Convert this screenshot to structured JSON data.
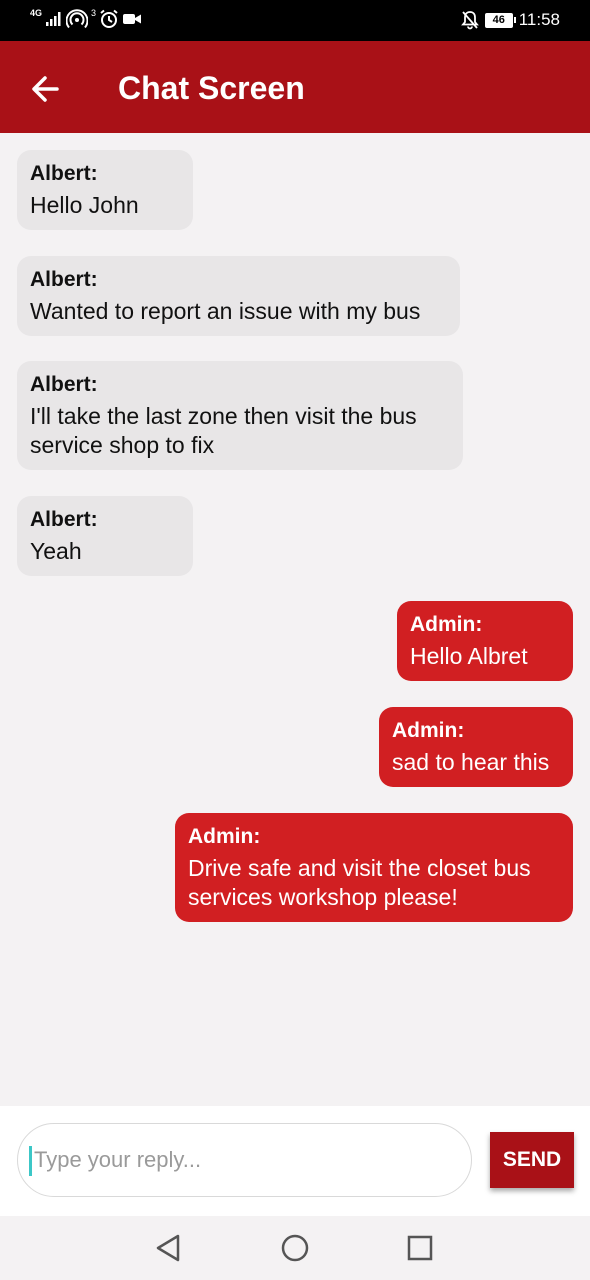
{
  "status_bar": {
    "network": "4G",
    "time": "11:58",
    "battery": "46"
  },
  "app_bar": {
    "title": "Chat Screen"
  },
  "messages": [
    {
      "sender": "Albert:",
      "text": "Hello John",
      "direction": "incoming"
    },
    {
      "sender": "Albert:",
      "text": "Wanted to report an issue with my bus",
      "direction": "incoming"
    },
    {
      "sender": "Albert:",
      "text": "I'll take the last zone then visit the bus service shop to fix",
      "direction": "incoming"
    },
    {
      "sender": "Albert:",
      "text": "Yeah",
      "direction": "incoming"
    },
    {
      "sender": "Admin:",
      "text": "Hello Albret",
      "direction": "outgoing"
    },
    {
      "sender": "Admin:",
      "text": "sad to hear this",
      "direction": "outgoing"
    },
    {
      "sender": "Admin:",
      "text": "Drive safe and visit the closet bus services workshop please!",
      "direction": "outgoing"
    }
  ],
  "composer": {
    "placeholder": "Type your reply...",
    "value": "",
    "send_label": "SEND"
  },
  "colors": {
    "app_bar": "#a91117",
    "outgoing_bubble": "#d11f22",
    "incoming_bubble": "#e8e6e7",
    "background": "#f4f2f3"
  }
}
